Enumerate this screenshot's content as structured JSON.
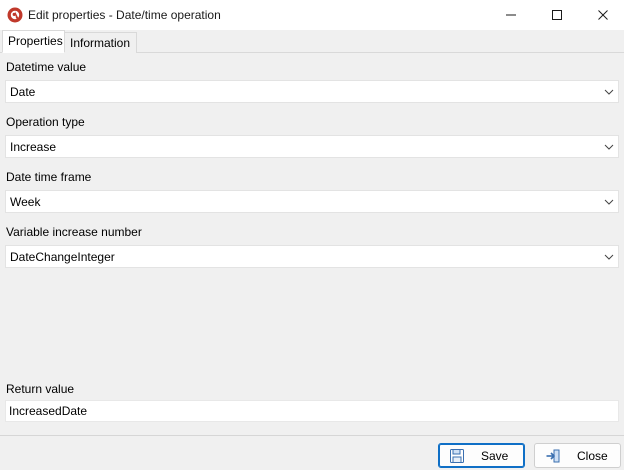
{
  "window": {
    "title": "Edit properties - Date/time operation"
  },
  "tabs": [
    {
      "label": "Properties",
      "active": true
    },
    {
      "label": "Information",
      "active": false
    }
  ],
  "fields": {
    "datetime_value": {
      "label": "Datetime value",
      "value": "Date"
    },
    "operation_type": {
      "label": "Operation type",
      "value": "Increase"
    },
    "date_time_frame": {
      "label": "Date time frame",
      "value": "Week"
    },
    "variable_increase_number": {
      "label": "Variable increase number",
      "value": "DateChangeInteger"
    },
    "return_value": {
      "label": "Return value",
      "value": "IncreasedDate"
    }
  },
  "buttons": {
    "save_label": "Save",
    "close_label": "Close"
  },
  "colors": {
    "app_icon": "#c0392b",
    "save_border": "#0f6fc6",
    "background": "#f0f0f0"
  },
  "icons": {
    "app": "app-logo-icon",
    "minimize": "minimize-icon",
    "maximize": "maximize-icon",
    "close": "close-icon",
    "dropdown": "chevron-down-icon",
    "save": "floppy-disk-icon",
    "close_button": "exit-arrow-icon"
  }
}
